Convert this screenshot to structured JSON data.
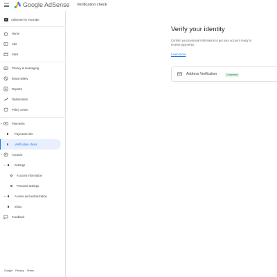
{
  "header": {
    "brand_google": "Google",
    "brand_product": "AdSense",
    "page_title": "Verification check"
  },
  "sidebar": {
    "account_label": "AdSense for YouTube",
    "items": [
      {
        "label": "Home",
        "icon": "home-icon"
      },
      {
        "label": "Ads",
        "icon": "ads-icon"
      },
      {
        "label": "Sites",
        "icon": "sites-icon"
      },
      {
        "label": "Privacy & messaging",
        "icon": "privacy-icon"
      },
      {
        "label": "Brand safety",
        "icon": "brand-safety-icon"
      },
      {
        "label": "Reports",
        "icon": "reports-icon"
      },
      {
        "label": "Optimization",
        "icon": "optimization-icon"
      },
      {
        "label": "Policy center",
        "icon": "policy-icon"
      },
      {
        "label": "Payments",
        "icon": "payments-icon"
      },
      {
        "label": "Payments info"
      },
      {
        "label": "Verification check"
      },
      {
        "label": "Account",
        "icon": "account-icon"
      },
      {
        "label": "Settings"
      },
      {
        "label": "Account information"
      },
      {
        "label": "Personal settings"
      },
      {
        "label": "Access and authorization"
      },
      {
        "label": "Inbox"
      },
      {
        "label": "Feedback",
        "icon": "feedback-icon"
      }
    ],
    "active_item": "Verification check"
  },
  "footer": {
    "links": [
      "Google",
      "Privacy",
      "Terms"
    ]
  },
  "main": {
    "title": "Verify your identity",
    "description": "Confirm your personal information to get your account ready to receive payments.",
    "learn_more": "Learn more",
    "card": {
      "title": "Address Verification",
      "status": "Completed",
      "icon": "mail-icon"
    }
  },
  "colors": {
    "accent": "#1a73e8",
    "active_bg": "#e8f0fe",
    "badge_bg": "#e6f4ea",
    "badge_text": "#137333"
  }
}
